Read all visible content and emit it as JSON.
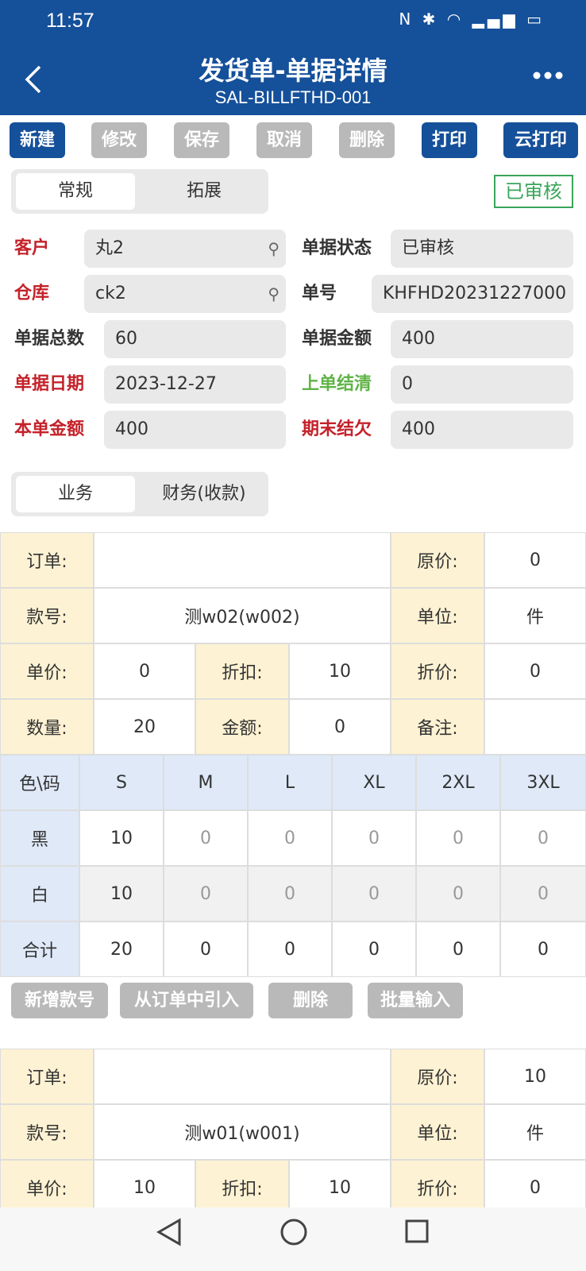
{
  "status": {
    "time": "11:57",
    "icons": "N ✱ ◠ ▂▄▆ ▭"
  },
  "header": {
    "title": "发货单-单据详情",
    "subtitle": "SAL-BILLFTHD-001"
  },
  "toolbar": {
    "new": "新建",
    "edit": "修改",
    "save": "保存",
    "cancel": "取消",
    "delete": "删除",
    "print": "打印",
    "cloud_print": "云打印"
  },
  "tabs1": {
    "general": "常规",
    "extend": "拓展"
  },
  "badge": "已审核",
  "fields": {
    "customer": {
      "label": "客户",
      "value": "丸2"
    },
    "status": {
      "label": "单据状态",
      "value": "已审核"
    },
    "warehouse": {
      "label": "仓库",
      "value": "ck2"
    },
    "number": {
      "label": "单号",
      "value": "KHFHD20231227000"
    },
    "total_count": {
      "label": "单据总数",
      "value": "60"
    },
    "total_amount": {
      "label": "单据金额",
      "value": "400"
    },
    "date": {
      "label": "单据日期",
      "value": "2023-12-27"
    },
    "prev_settle": {
      "label": "上单结清",
      "value": "0"
    },
    "this_amount": {
      "label": "本单金额",
      "value": "400"
    },
    "end_owe": {
      "label": "期末结欠",
      "value": "400"
    }
  },
  "tabs2": {
    "business": "业务",
    "finance": "财务(收款)"
  },
  "item1": {
    "order_label": "订单:",
    "order": "",
    "orig_price_label": "原价:",
    "orig_price": "0",
    "style_label": "款号:",
    "style": "测w02(w002)",
    "unit_label": "单位:",
    "unit": "件",
    "price_label": "单价:",
    "price": "0",
    "discount_label": "折扣:",
    "discount": "10",
    "disc_price_label": "折价:",
    "disc_price": "0",
    "qty_label": "数量:",
    "qty": "20",
    "amount_label": "金额:",
    "amount": "0",
    "remark_label": "备注:",
    "remark": ""
  },
  "size_table": {
    "headers": [
      "色\\码",
      "S",
      "M",
      "L",
      "XL",
      "2XL",
      "3XL"
    ],
    "rows": [
      [
        "黑",
        "10",
        "0",
        "0",
        "0",
        "0",
        "0"
      ],
      [
        "白",
        "10",
        "0",
        "0",
        "0",
        "0",
        "0"
      ],
      [
        "合计",
        "20",
        "0",
        "0",
        "0",
        "0",
        "0"
      ]
    ]
  },
  "actions": {
    "add_style": "新增款号",
    "import_order": "从订单中引入",
    "delete": "删除",
    "batch": "批量输入"
  },
  "item2": {
    "order_label": "订单:",
    "order": "",
    "orig_price_label": "原价:",
    "orig_price": "10",
    "style_label": "款号:",
    "style": "测w01(w001)",
    "unit_label": "单位:",
    "unit": "件",
    "price_label": "单价:",
    "price": "10",
    "discount_label": "折扣:",
    "discount": "10",
    "disc_price_label": "折价:",
    "disc_price": "0"
  }
}
